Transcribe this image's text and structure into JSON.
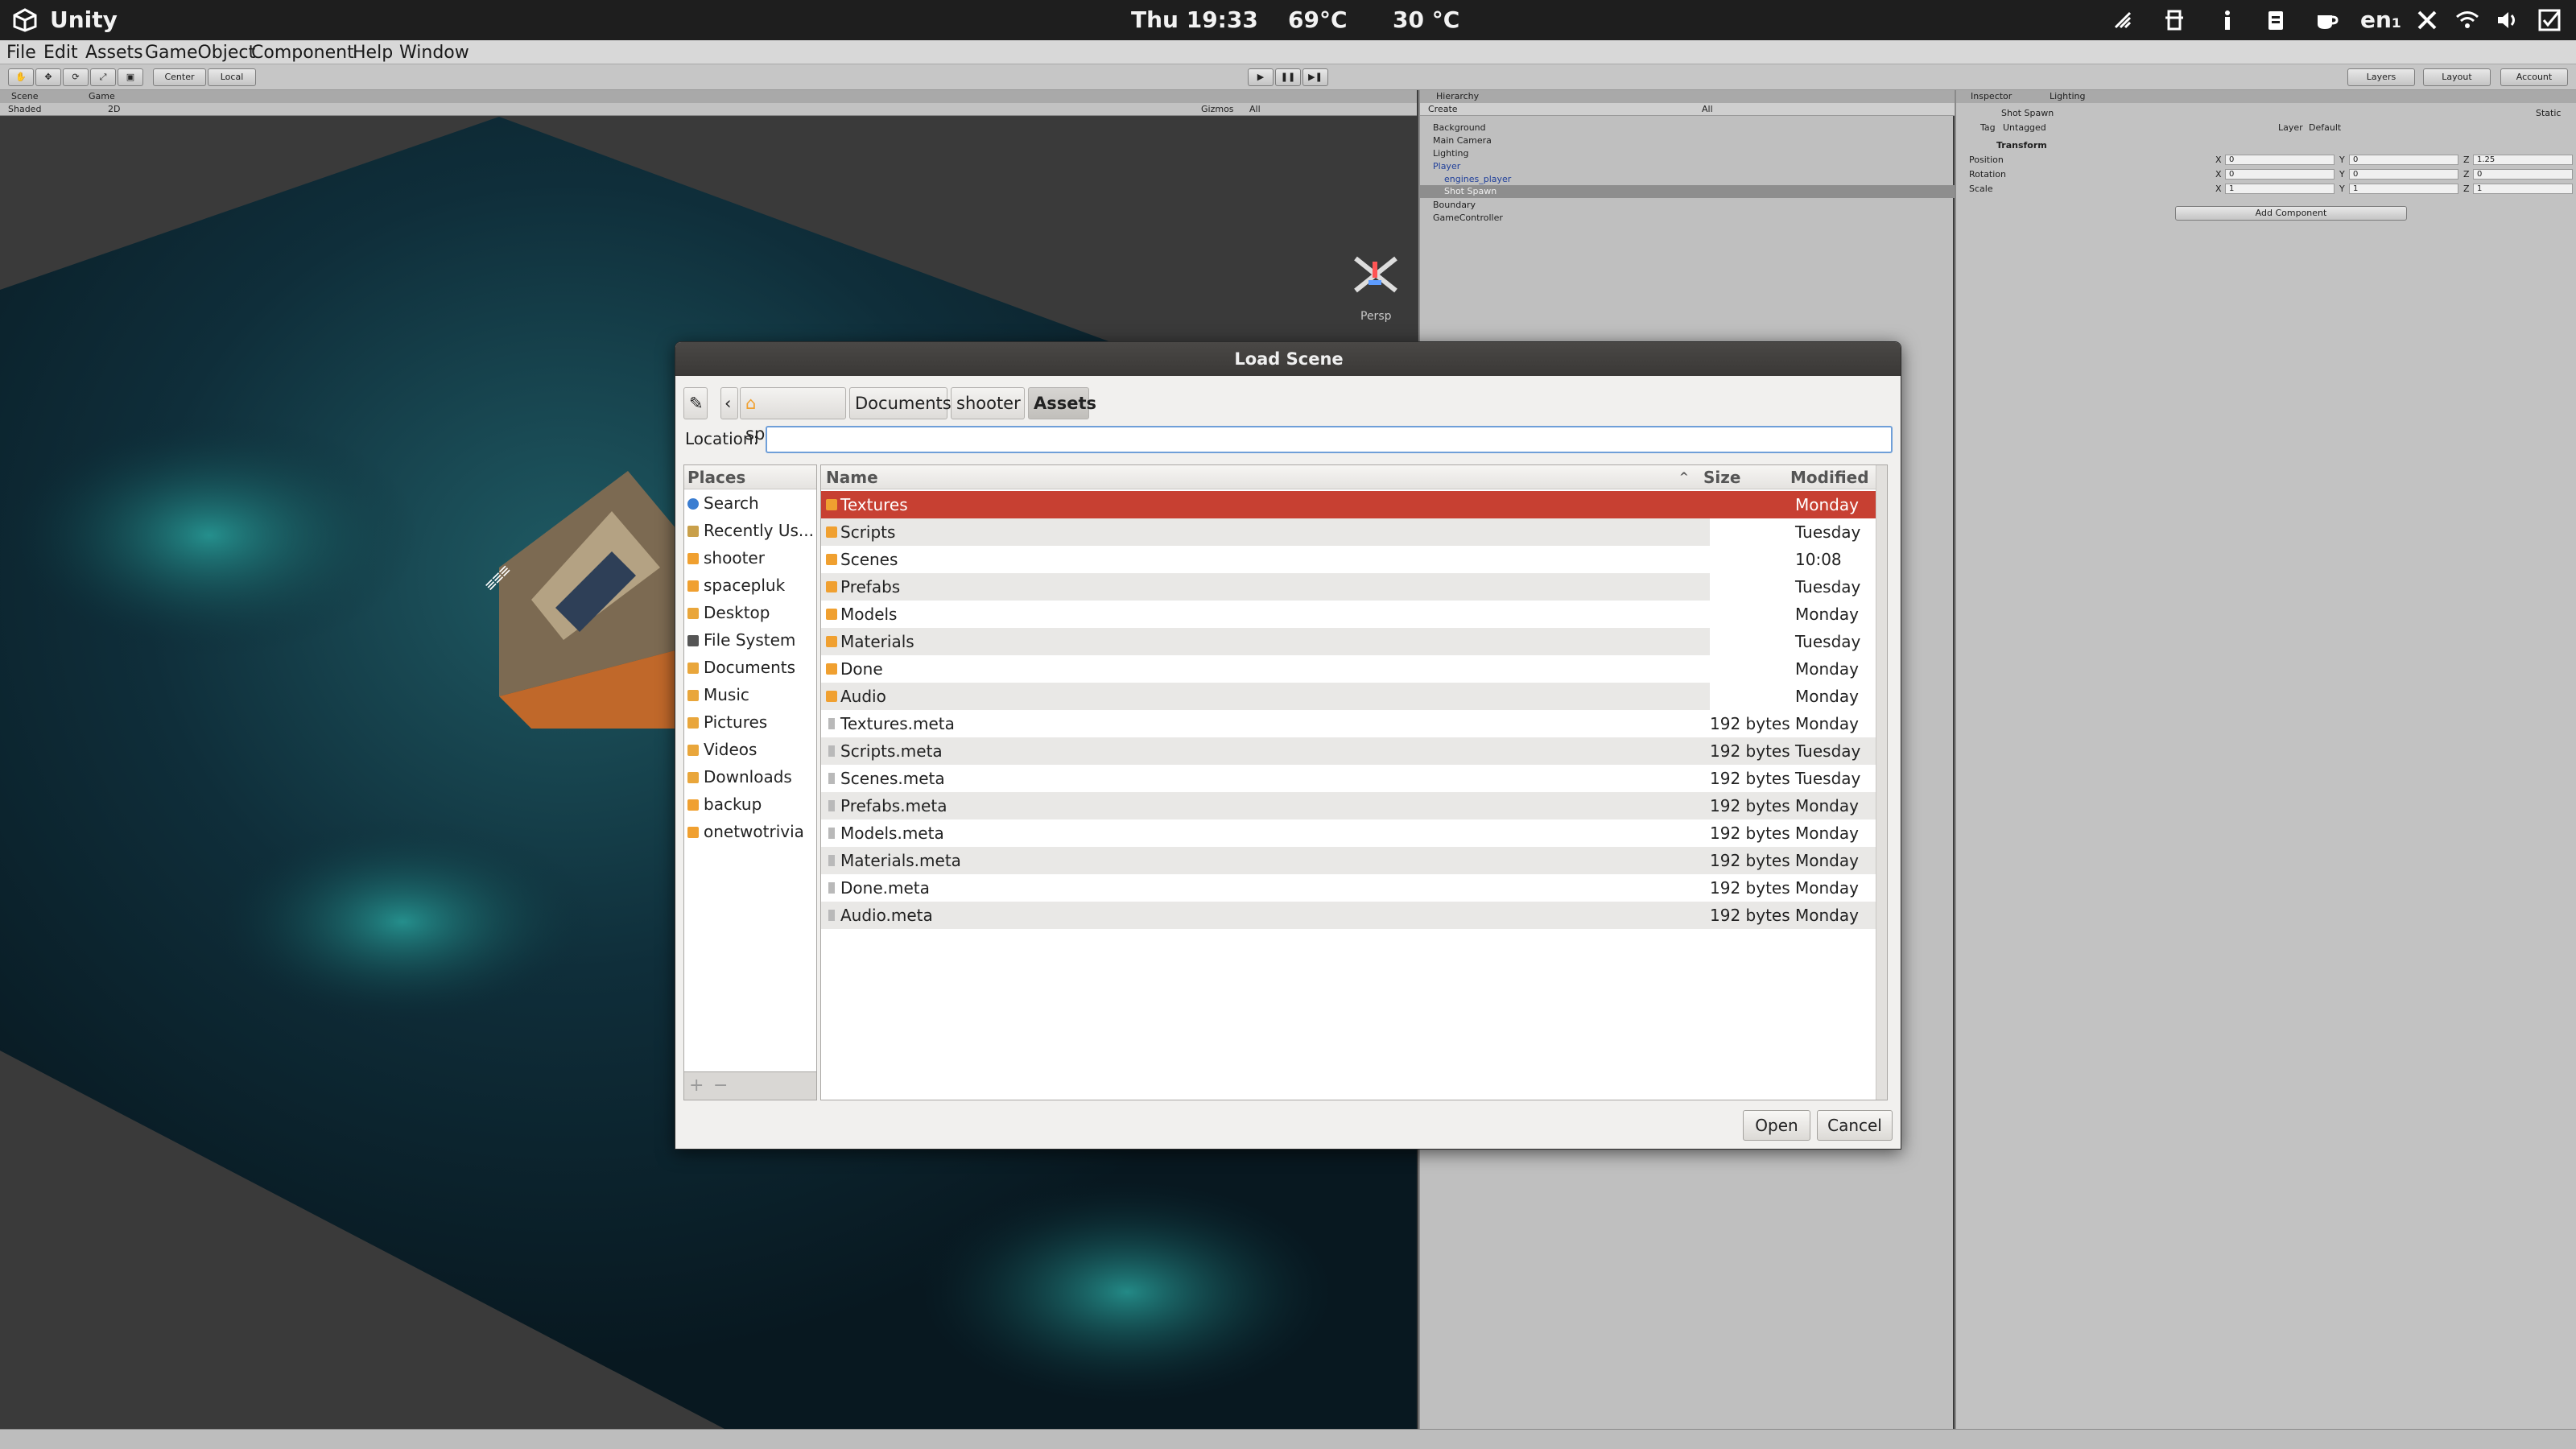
{
  "system": {
    "app_name": "Unity",
    "clock": "Thu 19:33",
    "temperature": "69°C",
    "weather": "30 °C",
    "language": "en₁"
  },
  "menu": [
    "File",
    "Edit",
    "Assets",
    "GameObject",
    "Component",
    "Help",
    "Window"
  ],
  "toolbar": {
    "pivot": "Center",
    "space": "Local",
    "layers": "Layers",
    "layout": "Layout",
    "account": "Account"
  },
  "scene": {
    "tab_scene": "Scene",
    "tab_game": "Game",
    "shading": "Shaded",
    "mode": "2D",
    "gizmos": "Gizmos",
    "search": "All",
    "persp": "Persp"
  },
  "hierarchy": {
    "title": "Hierarchy",
    "create": "Create",
    "search": "All",
    "items": [
      "Background",
      "Main Camera",
      "Lighting",
      "Player",
      "engines_player",
      "Shot Spawn",
      "Boundary",
      "GameController"
    ]
  },
  "inspector": {
    "tab_inspector": "Inspector",
    "tab_lighting": "Lighting",
    "object_name": "Shot Spawn",
    "static": "Static",
    "tag_label": "Tag",
    "tag_value": "Untagged",
    "layer_label": "Layer",
    "layer_value": "Default",
    "component": "Transform",
    "rows": [
      {
        "label": "Position",
        "x": "0",
        "y": "0",
        "z": "1.25"
      },
      {
        "label": "Rotation",
        "x": "0",
        "y": "0",
        "z": "0"
      },
      {
        "label": "Scale",
        "x": "1",
        "y": "1",
        "z": "1"
      }
    ],
    "axis_x": "X",
    "axis_y": "Y",
    "axis_z": "Z",
    "add_component": "Add Component"
  },
  "dialog": {
    "title": "Load Scene",
    "crumbs": [
      "spacepluk",
      "Documents",
      "shooter",
      "Assets"
    ],
    "location_label": "Location:",
    "location_value": "",
    "places_header": "Places",
    "places": [
      {
        "label": "Search",
        "icon": "search-icon"
      },
      {
        "label": "Recently Us...",
        "icon": "recent-icon"
      },
      {
        "label": "shooter",
        "icon": "folder-icon"
      },
      {
        "label": "spacepluk",
        "icon": "home-icon"
      },
      {
        "label": "Desktop",
        "icon": "desktop-icon"
      },
      {
        "label": "File System",
        "icon": "drive-icon"
      },
      {
        "label": "Documents",
        "icon": "documents-icon"
      },
      {
        "label": "Music",
        "icon": "music-icon"
      },
      {
        "label": "Pictures",
        "icon": "pictures-icon"
      },
      {
        "label": "Videos",
        "icon": "videos-icon"
      },
      {
        "label": "Downloads",
        "icon": "downloads-icon"
      },
      {
        "label": "backup",
        "icon": "folder-icon"
      },
      {
        "label": "onetwotrivia",
        "icon": "folder-icon"
      }
    ],
    "columns": {
      "name": "Name",
      "size": "Size",
      "modified": "Modified"
    },
    "files": [
      {
        "name": "Textures",
        "size": "",
        "modified": "Monday",
        "type": "folder"
      },
      {
        "name": "Scripts",
        "size": "",
        "modified": "Tuesday",
        "type": "folder"
      },
      {
        "name": "Scenes",
        "size": "",
        "modified": "10:08",
        "type": "folder"
      },
      {
        "name": "Prefabs",
        "size": "",
        "modified": "Tuesday",
        "type": "folder"
      },
      {
        "name": "Models",
        "size": "",
        "modified": "Monday",
        "type": "folder"
      },
      {
        "name": "Materials",
        "size": "",
        "modified": "Tuesday",
        "type": "folder"
      },
      {
        "name": "Done",
        "size": "",
        "modified": "Monday",
        "type": "folder"
      },
      {
        "name": "Audio",
        "size": "",
        "modified": "Monday",
        "type": "folder"
      },
      {
        "name": "Textures.meta",
        "size": "192 bytes",
        "modified": "Monday",
        "type": "file"
      },
      {
        "name": "Scripts.meta",
        "size": "192 bytes",
        "modified": "Tuesday",
        "type": "file"
      },
      {
        "name": "Scenes.meta",
        "size": "192 bytes",
        "modified": "Tuesday",
        "type": "file"
      },
      {
        "name": "Prefabs.meta",
        "size": "192 bytes",
        "modified": "Monday",
        "type": "file"
      },
      {
        "name": "Models.meta",
        "size": "192 bytes",
        "modified": "Monday",
        "type": "file"
      },
      {
        "name": "Materials.meta",
        "size": "192 bytes",
        "modified": "Monday",
        "type": "file"
      },
      {
        "name": "Done.meta",
        "size": "192 bytes",
        "modified": "Monday",
        "type": "file"
      },
      {
        "name": "Audio.meta",
        "size": "192 bytes",
        "modified": "Monday",
        "type": "file"
      }
    ],
    "open_label": "Open",
    "cancel_label": "Cancel"
  },
  "colors": {
    "selection": "#c74032",
    "folder": "#f0a030",
    "title_bar": "#3f3d3b"
  }
}
